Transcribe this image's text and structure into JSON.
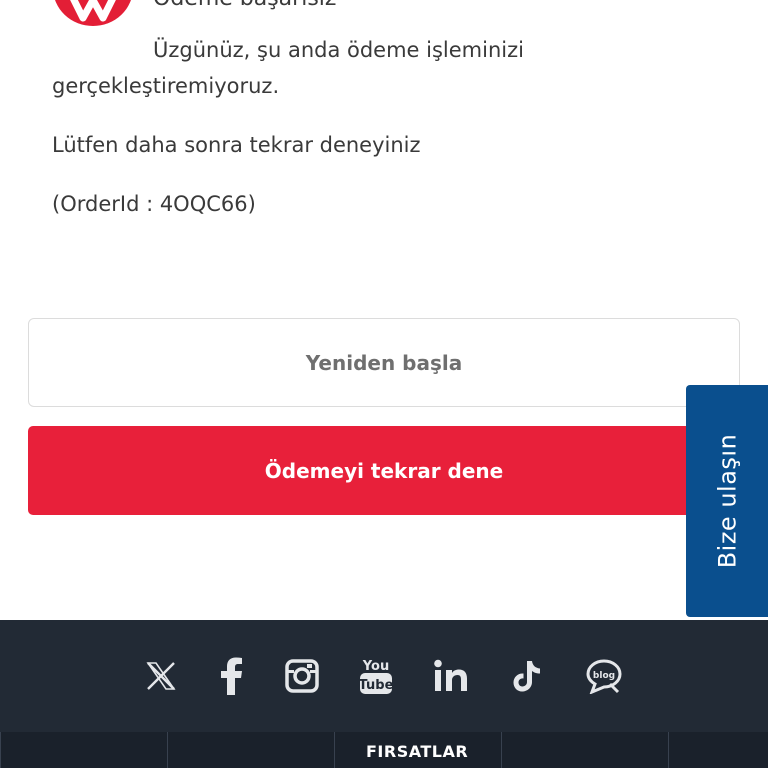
{
  "message": {
    "heading_partial": "Ödeme başarısız",
    "line1": "Üzgünüz, şu anda ödeme işleminizi gerçekleştiremiyoruz.",
    "line2": "Lütfen daha sonra tekrar deneyiniz",
    "order_id": "(OrderId : 4OQC66)"
  },
  "buttons": {
    "restart_label": "Yeniden başla",
    "retry_label": "Ödemeyi tekrar dene"
  },
  "contact_tab": {
    "label": "Bize ulaşın"
  },
  "footer": {
    "social_icons": [
      "x-icon",
      "facebook-icon",
      "instagram-icon",
      "youtube-icon",
      "linkedin-icon",
      "tiktok-icon",
      "blog-icon"
    ],
    "menu_partial_label": "FIRSATLAR"
  },
  "colors": {
    "brand_red": "#e8203a",
    "contact_blue": "#0a4f8e",
    "footer_bg": "#222a35"
  }
}
